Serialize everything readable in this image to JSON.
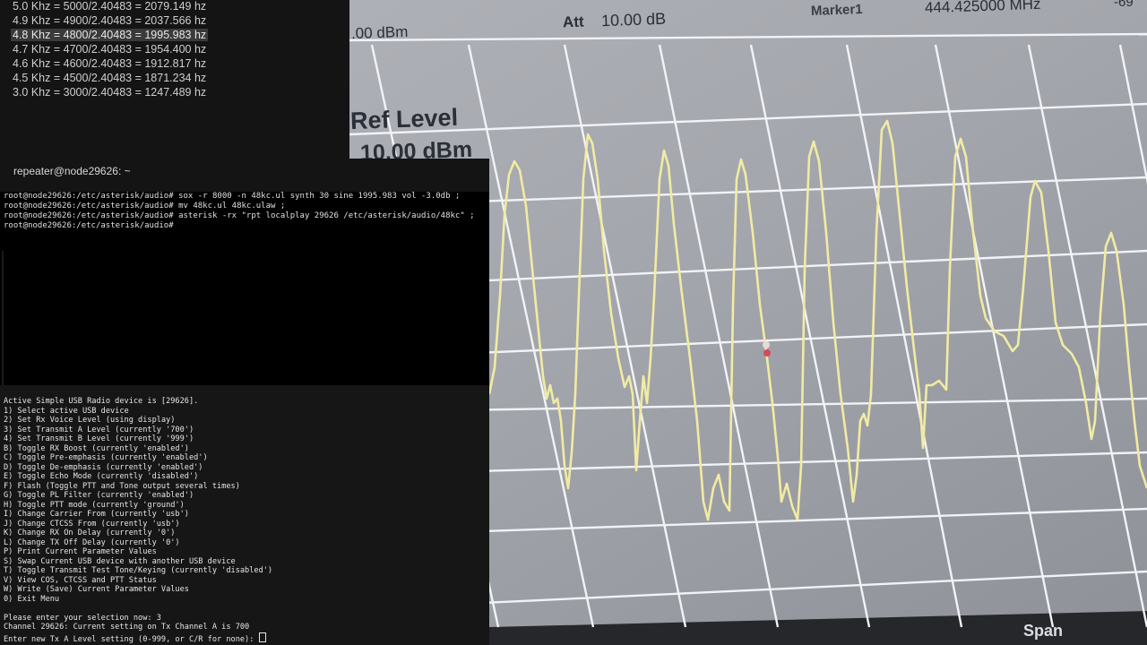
{
  "freq_table": [
    "5.0 Khz = 5000/2.40483 = 2079.149 hz",
    "4.9 Khz = 4900/2.40483 = 2037.566 hz",
    "4.8 Khz = 4800/2.40483 = 1995.983 hz",
    "4.7 Khz = 4700/2.40483 = 1954.400 hz",
    "4.6 Khz = 4600/2.40483 = 1912.817 hz",
    "4.5 Khz = 4500/2.40483 = 1871.234 hz",
    "3.0 Khz = 3000/2.40483 = 1247.489 hz"
  ],
  "terminal": {
    "title": "repeater@node29626: ~",
    "lines": [
      "root@node29626:/etc/asterisk/audio# sox -r 8000 -n 48kc.ul synth 30 sine 1995.983 vol -3.0db ;",
      "root@node29626:/etc/asterisk/audio# mv 48kc.ul 48kc.ulaw ;",
      "root@node29626:/etc/asterisk/audio# asterisk -rx \"rpt localplay 29626 /etc/asterisk/audio/48kc\" ;",
      "root@node29626:/etc/asterisk/audio# "
    ]
  },
  "menu": {
    "header": "Active Simple USB Radio device is [29626].",
    "items": [
      "1) Select active USB device",
      "2) Set Rx Voice Level (using display)",
      "3) Set Transmit A Level (currently '700')",
      "4) Set Transmit B Level (currently '999')",
      "B) Toggle RX Boost (currently 'enabled')",
      "C) Toggle Pre-emphasis (currently 'enabled')",
      "D) Toggle De-emphasis (currently 'enabled')",
      "E) Toggle Echo Mode (currently 'disabled')",
      "F) Flash (Toggle PTT and Tone output several times)",
      "G) Toggle PL Filter (currently 'enabled')",
      "H) Toggle PTT mode (currently 'ground')",
      "I) Change Carrier From (currently 'usb')",
      "J) Change CTCSS From (currently 'usb')",
      "K) Change RX On Delay (currently '0')",
      "L) Change TX Off Delay (currently '0')",
      "P) Print Current Parameter Values",
      "S) Swap Current USB device with another USB device",
      "T) Toggle Transmit Test Tone/Keying (currently 'disabled')",
      "V) View COS, CTCSS and PTT Status",
      "W) Write (Save) Current Parameter Values",
      "0) Exit Menu"
    ],
    "prompt": "Please enter your selection now: 3",
    "status": "Channel 29626: Current setting on Tx Channel A is 700",
    "input_prompt": "Enter new Tx A Level setting (0-999, or C/R for none): "
  },
  "scope": {
    "att_label": "Att",
    "att_value": "10.00 dB",
    "marker_label": "Marker1",
    "marker_freq": "444.425000 MHz",
    "corner_value": "-69",
    "top_left_value": ".00 dBm",
    "ref_label": "Ref Level",
    "ref_value": "10.00 dBm",
    "span_label": "Span"
  },
  "colors": {
    "scope_bg": "#a4a7ac",
    "grid": "#f2f3f6",
    "trace": "#f1eba3",
    "marker": "#d84a5a"
  }
}
